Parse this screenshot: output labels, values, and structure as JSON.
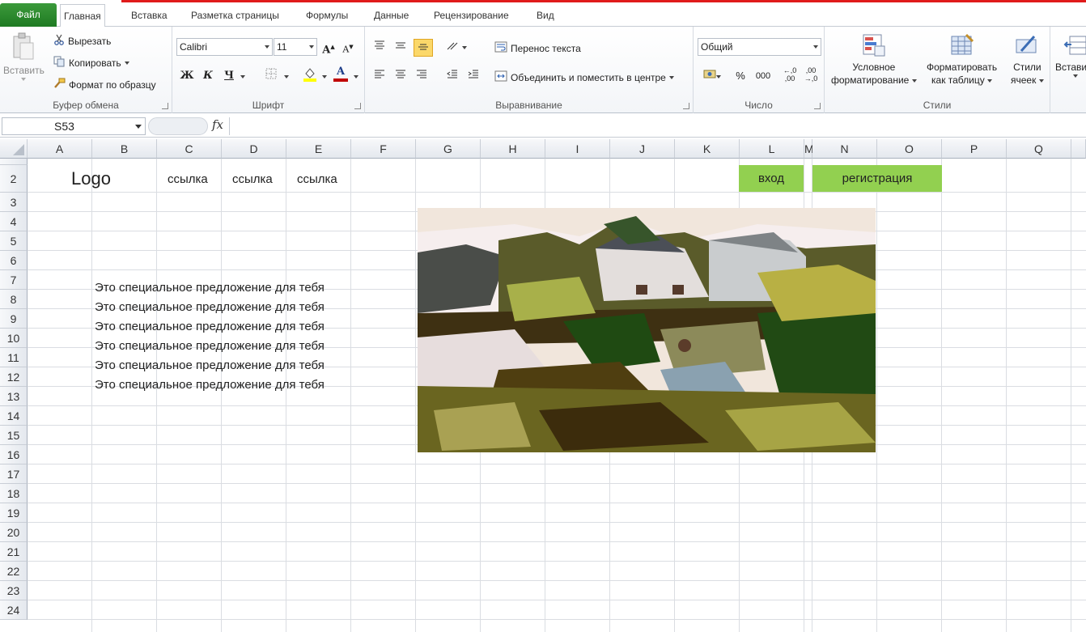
{
  "tabs": {
    "file": "Файл",
    "items": [
      "Главная",
      "Вставка",
      "Разметка страницы",
      "Формулы",
      "Данные",
      "Рецензирование",
      "Вид"
    ],
    "active": "Главная"
  },
  "clipboard": {
    "paste": "Вставить",
    "cut": "Вырезать",
    "copy": "Копировать",
    "format_painter": "Формат по образцу",
    "label": "Буфер обмена"
  },
  "font": {
    "name": "Calibri",
    "size": "11",
    "bold": "Ж",
    "italic": "К",
    "underline": "Ч",
    "grow": "A",
    "shrink": "A",
    "font_color_letter": "A",
    "label": "Шрифт",
    "fill_color": "#ffff00",
    "font_color": "#c00000"
  },
  "alignment": {
    "wrap_text": "Перенос текста",
    "merge_center": "Объединить и поместить в центре",
    "label": "Выравнивание"
  },
  "number": {
    "format": "Общий",
    "percent": "%",
    "thousands": "000",
    "inc_decimal": "←,0 ,00",
    "dec_decimal": ",00 →,0",
    "label": "Число"
  },
  "styles": {
    "conditional": [
      "Условное",
      "форматирование"
    ],
    "as_table": [
      "Форматировать",
      "как таблицу"
    ],
    "cell_styles": [
      "Стили",
      "ячеек"
    ],
    "label": "Стили"
  },
  "cells": {
    "insert": "Вставить"
  },
  "formula_bar": {
    "name_box": "S53",
    "fx": "fx",
    "formula": ""
  },
  "columns": [
    "A",
    "B",
    "C",
    "D",
    "E",
    "F",
    "G",
    "H",
    "I",
    "J",
    "K",
    "L",
    "M",
    "N",
    "O",
    "P",
    "Q"
  ],
  "rows": [
    "2",
    "3",
    "4",
    "5",
    "6",
    "7",
    "8",
    "9",
    "10",
    "11",
    "12",
    "13",
    "14",
    "15",
    "16",
    "17",
    "18",
    "19",
    "20",
    "21",
    "22",
    "23",
    "24"
  ],
  "sheet": {
    "logo": "Logo",
    "links": [
      "ссылка",
      "ссылка",
      "ссылка"
    ],
    "login": "вход",
    "register": "регистрация",
    "offers": [
      "Это специальное предложение для тебя",
      "Это специальное предложение для тебя",
      "Это специальное предложение для тебя",
      "Это специальное предложение для тебя",
      "Это специальное предложение для тебя",
      "Это специальное предложение для тебя"
    ],
    "button_color": "#92d050"
  },
  "picture": {
    "icon": "landscape-picture"
  }
}
